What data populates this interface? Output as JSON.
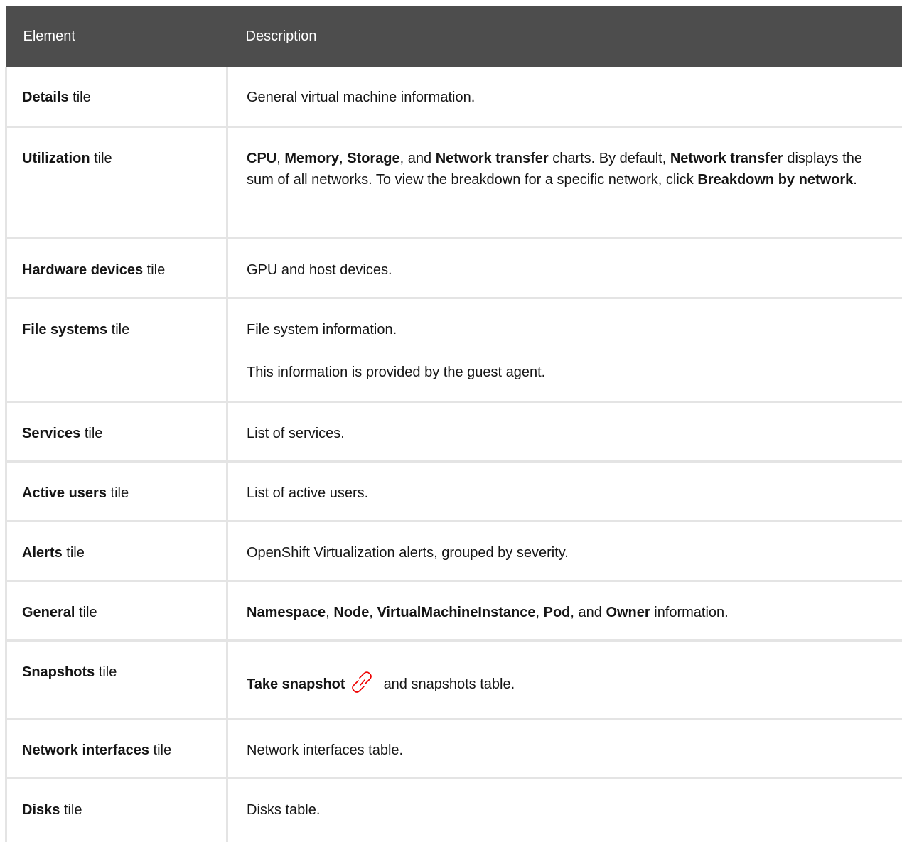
{
  "header": {
    "col1": "Element",
    "col2": "Description"
  },
  "suffix": " tile",
  "rows": {
    "details": {
      "name": "Details",
      "desc": "General virtual machine information."
    },
    "utilization": {
      "name": "Utilization",
      "t_cpu": "CPU",
      "sep1": ", ",
      "t_memory": "Memory",
      "sep2": ", ",
      "t_storage": "Storage",
      "sep3": ", and ",
      "t_network1": "Network transfer",
      "text1": " charts. By default, ",
      "t_network2": "Network transfer",
      "text2": " displays the sum of all networks. To view the breakdown for a specific network, click ",
      "t_breakdown": "Breakdown by network",
      "end": "."
    },
    "hardware": {
      "name": "Hardware devices",
      "desc": "GPU and host devices."
    },
    "filesystems": {
      "name": "File systems",
      "desc1": "File system information.",
      "desc2": "This information is provided by the guest agent."
    },
    "services": {
      "name": "Services",
      "desc": "List of services."
    },
    "active_users": {
      "name": "Active users",
      "desc": "List of active users."
    },
    "alerts": {
      "name": "Alerts",
      "desc": "OpenShift Virtualization alerts, grouped by severity."
    },
    "general": {
      "name": "General",
      "t_namespace": "Namespace",
      "sep1": ", ",
      "t_node": "Node",
      "sep2": ", ",
      "t_vmi": "VirtualMachineInstance",
      "sep3": ", ",
      "t_pod": "Pod",
      "sep4": ", and ",
      "t_owner": "Owner",
      "text": " information."
    },
    "snapshots": {
      "name": "Snapshots",
      "t_take": "Take snapshot",
      "text": "and snapshots table."
    },
    "network_interfaces": {
      "name": "Network interfaces",
      "desc": "Network interfaces table."
    },
    "disks": {
      "name": "Disks",
      "desc": "Disks table."
    }
  },
  "icons": {
    "snapshot_link": "link-icon"
  },
  "colors": {
    "header_bg": "#4d4d4d",
    "border": "#e4e4e4",
    "link_icon": "#ee0000"
  }
}
